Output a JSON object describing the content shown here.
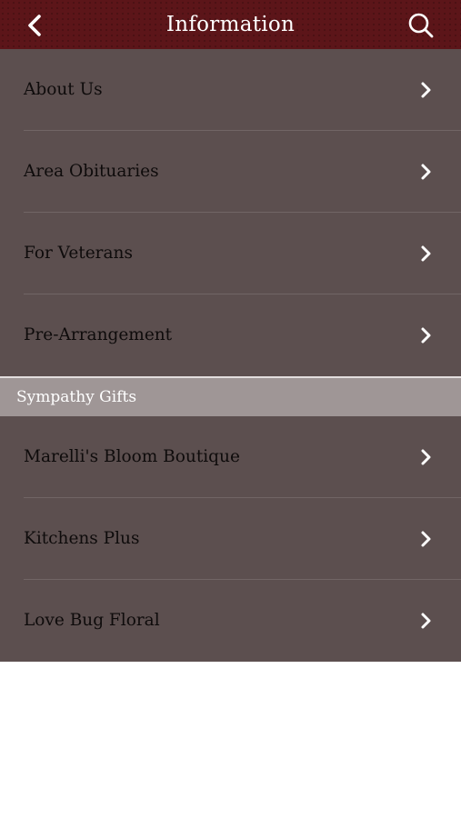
{
  "header": {
    "title": "Information",
    "back_icon": "chevron-left-icon",
    "search_icon": "search-icon"
  },
  "section1": {
    "items": [
      {
        "label": "About Us"
      },
      {
        "label": "Area Obituaries"
      },
      {
        "label": "For Veterans"
      },
      {
        "label": "Pre-Arrangement"
      }
    ]
  },
  "section2": {
    "title": "Sympathy Gifts",
    "items": [
      {
        "label": "Marelli's Bloom Boutique"
      },
      {
        "label": "Kitchens Plus"
      },
      {
        "label": "Love Bug Floral"
      }
    ]
  },
  "colors": {
    "nav_bg": "#5c1519",
    "list_bg": "#5c4f4f",
    "section_header_bg": "#9f9696",
    "row_text": "#0e0b0b",
    "chevron": "#ffffff"
  }
}
